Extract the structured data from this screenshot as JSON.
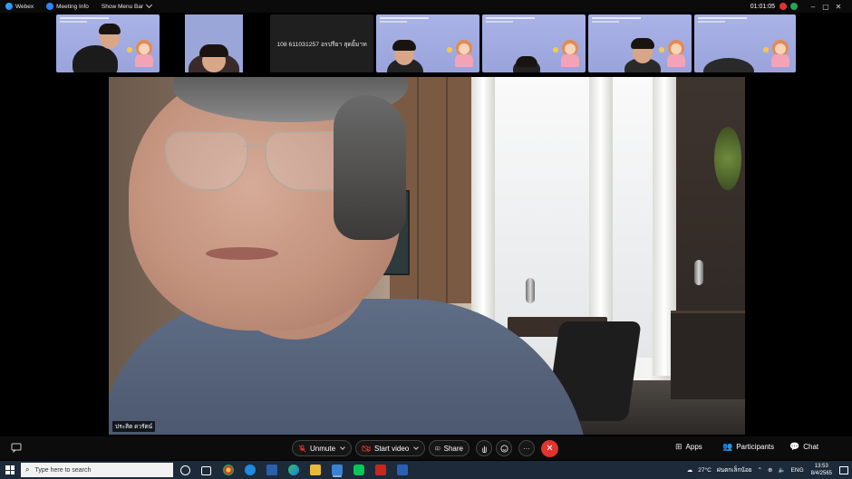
{
  "titlebar": {
    "app_name": "Webex",
    "meeting_info": "Meeting Info",
    "show_menu_bar": "Show Menu Bar",
    "timer": "01:01:05",
    "min_glyph": "–",
    "max_glyph": "▢",
    "close_glyph": "✕"
  },
  "thumbnails": [
    {
      "type": "video-slide"
    },
    {
      "type": "video-person"
    },
    {
      "type": "name",
      "label": "108 611031257 อรปรียา สุดยิ้มาท"
    },
    {
      "type": "video-slide"
    },
    {
      "type": "video-slide"
    },
    {
      "type": "video-slide"
    },
    {
      "type": "video-slide"
    }
  ],
  "main_video": {
    "participant_name": "ประสิต ดวรัตน์"
  },
  "controls": {
    "unmute": "Unmute",
    "start_video": "Start video",
    "share": "Share",
    "apps": "Apps",
    "participants": "Participants",
    "chat": "Chat",
    "more_glyph": "···",
    "end_glyph": "✕"
  },
  "taskbar": {
    "search_placeholder": "Type here to search",
    "weather": "27°C",
    "weather_status": "ฝนตกเล็กน้อย",
    "language": "ENG",
    "time": "13:53",
    "date": "8/4/2565"
  },
  "colors": {
    "accent_red": "#e2332d",
    "thumb_bg": "#a9b3e6",
    "security_green": "#23a55a"
  }
}
